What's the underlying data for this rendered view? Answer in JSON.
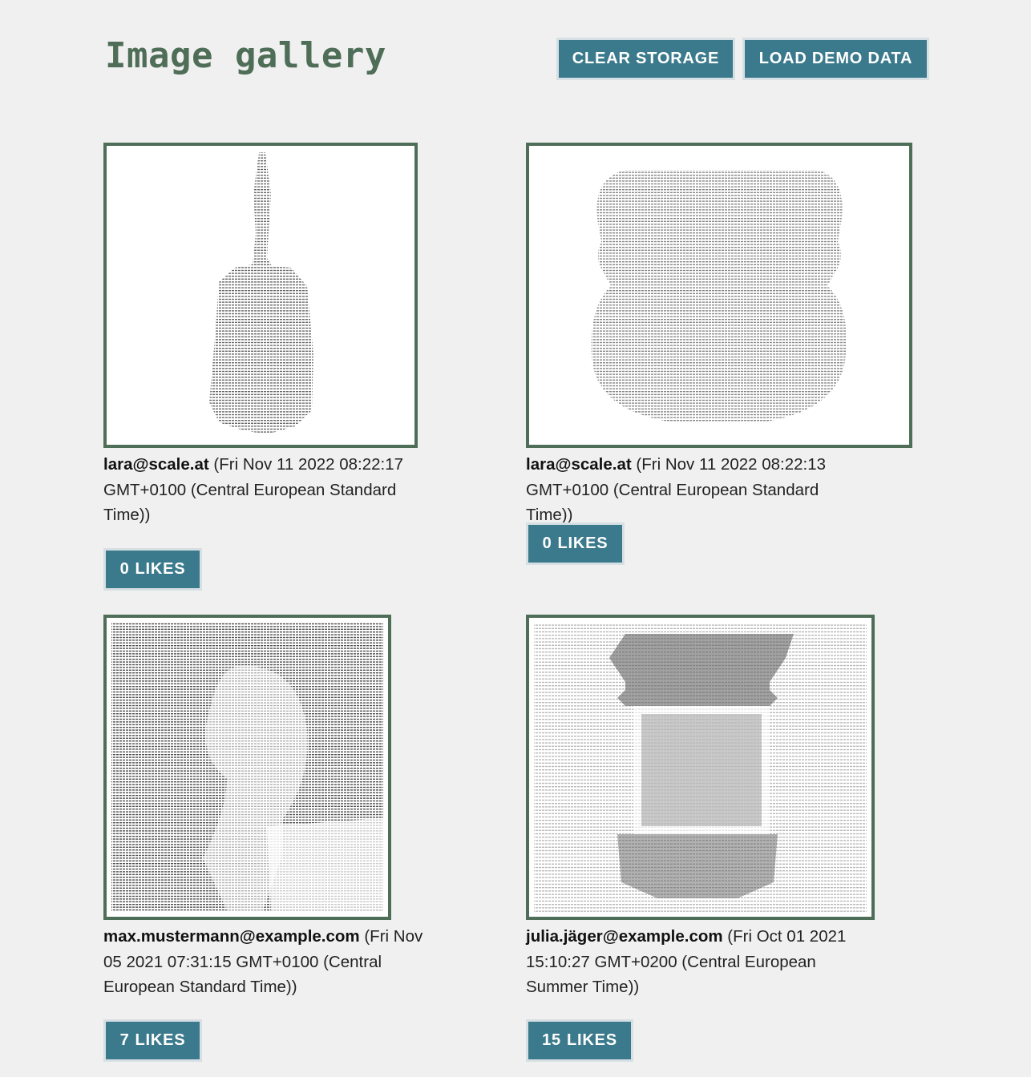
{
  "header": {
    "title": "Image gallery",
    "clear_label": "CLEAR STORAGE",
    "load_label": "LOAD DEMO DATA"
  },
  "colors": {
    "accent": "#3b7a8c",
    "frame": "#4f6e58",
    "background": "#f0f0f0"
  },
  "posts": [
    {
      "author": "lara@scale.at",
      "date": "(Fri Nov 11 2022 08:22:17 GMT+0100 (Central European Standard Time))",
      "likes": 0,
      "likes_label": "LIKES",
      "image": "ascii-art-bottle"
    },
    {
      "author": "lara@scale.at",
      "date": "(Fri Nov 11 2022 08:22:13 GMT+0100 (Central European Standard Time))",
      "likes": 0,
      "likes_label": "LIKES",
      "image": "ascii-art-animal-face"
    },
    {
      "author": "max.mustermann@example.com",
      "date": "(Fri Nov 05 2021 07:31:15 GMT+0100 (Central European Standard Time))",
      "likes": 7,
      "likes_label": "LIKES",
      "image": "ascii-art-portrait"
    },
    {
      "author": "julia.jäger@example.com",
      "date": "(Fri Oct 01 2021 15:10:27 GMT+0200 (Central European Summer Time))",
      "likes": 15,
      "likes_label": "LIKES",
      "image": "ascii-art-bottle-outline"
    }
  ]
}
